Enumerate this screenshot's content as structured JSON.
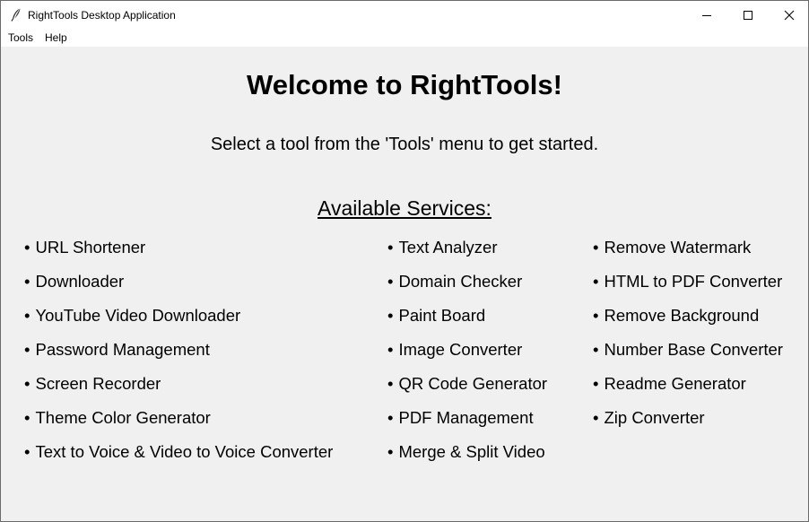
{
  "window": {
    "title": "RightTools Desktop Application",
    "icon": "feather-icon"
  },
  "menubar": {
    "items": [
      "Tools",
      "Help"
    ]
  },
  "main": {
    "welcome": "Welcome to RightTools!",
    "subtitle": "Select a tool from the 'Tools' menu to get started.",
    "services_heading": "Available Services:",
    "bullet": "•",
    "columns": [
      [
        "URL Shortener",
        "Downloader",
        "YouTube Video Downloader",
        "Password Management",
        "Screen Recorder",
        "Theme Color Generator",
        "Text to Voice & Video to Voice Converter"
      ],
      [
        "Text Analyzer",
        "Domain Checker",
        "Paint Board",
        "Image Converter",
        "QR Code Generator",
        "PDF Management",
        "Merge & Split Video"
      ],
      [
        "Remove Watermark",
        "HTML to PDF Converter",
        "Remove Background",
        "Number Base Converter",
        "Readme Generator",
        "Zip Converter"
      ]
    ]
  }
}
